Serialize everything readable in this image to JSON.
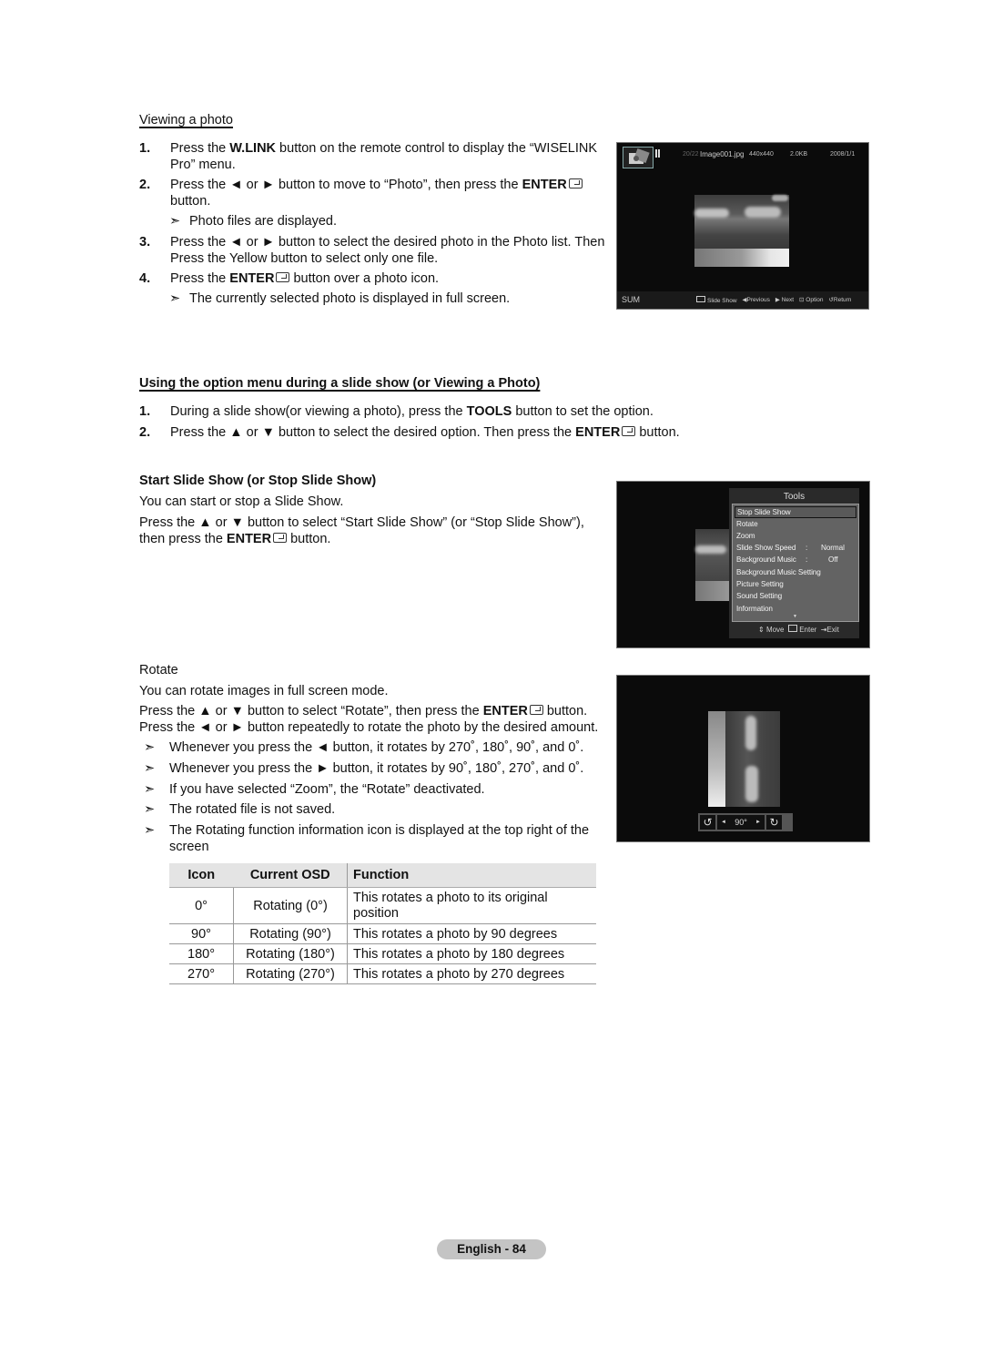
{
  "section1": {
    "heading": "Viewing a photo",
    "steps": [
      {
        "num": "1.",
        "parts": [
          {
            "t": "Press the "
          },
          {
            "b": "W.LINK"
          },
          {
            "t": " button on the remote control to display the “WISELINK Pro” menu."
          }
        ]
      },
      {
        "num": "2.",
        "parts": [
          {
            "t": "Press the ◄ or ► button to move to “Photo”, then press the "
          },
          {
            "b": "ENTER"
          },
          {
            "icon": "enter"
          },
          {
            "t": " button."
          }
        ]
      },
      {
        "num": "3.",
        "parts": [
          {
            "t": "Press the ◄ or ► button to select the desired photo in the Photo list. Then Press the Yellow button to select only one file."
          }
        ]
      },
      {
        "num": "4.",
        "parts": [
          {
            "t": "Press the "
          },
          {
            "b": "ENTER"
          },
          {
            "icon": "enter"
          },
          {
            "t": " button over a photo icon."
          }
        ]
      }
    ],
    "notes": {
      "after_step2": "Photo files are displayed.",
      "after_step4": "The currently selected photo is displayed in full screen."
    },
    "screen": {
      "counter": "20/22",
      "filename": "Image001.jpg",
      "resolution": "440x440",
      "filesize": "2.0KB",
      "date": "2008/1/1",
      "device": "SUM",
      "footer_buttons": [
        {
          "icon": "enter-icon",
          "label": "Slide Show"
        },
        {
          "icon": "left-triangle-icon",
          "label": "Previous"
        },
        {
          "icon": "right-triangle-icon",
          "label": "Next"
        },
        {
          "icon": "tools-icon",
          "label": "Option"
        },
        {
          "icon": "return-icon",
          "label": "Return"
        }
      ]
    }
  },
  "section2": {
    "heading": "Using the option menu during a slide show (or Viewing a Photo)",
    "steps": [
      {
        "num": "1.",
        "parts": [
          {
            "t": "During a slide show(or viewing a photo), press the "
          },
          {
            "b": "TOOLS"
          },
          {
            "t": " button to set the option."
          }
        ]
      },
      {
        "num": "2.",
        "parts": [
          {
            "t": "Press the ▲ or ▼ button to select the desired option. Then press the "
          },
          {
            "b": "ENTER"
          },
          {
            "icon": "enter"
          },
          {
            "t": " button."
          }
        ]
      }
    ]
  },
  "slideshow": {
    "heading": "Start Slide Show (or Stop Slide Show)",
    "line1": "You can start or stop a Slide Show.",
    "line2_parts": [
      {
        "t": "Press the ▲ or ▼ button to select “Start Slide Show” (or “Stop Slide Show”), then press the "
      },
      {
        "b": "ENTER"
      },
      {
        "icon": "enter"
      },
      {
        "t": " button."
      }
    ],
    "tools_menu": {
      "title": "Tools",
      "items": [
        {
          "label": "Stop Slide Show",
          "value": "",
          "selected": true
        },
        {
          "label": "Rotate",
          "value": ""
        },
        {
          "label": "Zoom",
          "value": ""
        },
        {
          "label": "Slide Show Speed",
          "sep": ":",
          "value": "Normal"
        },
        {
          "label": "Background Music",
          "sep": ":",
          "value": "Off"
        },
        {
          "label": "Background Music Setting",
          "value": ""
        },
        {
          "label": "Picture Setting",
          "value": ""
        },
        {
          "label": "Sound Setting",
          "value": ""
        },
        {
          "label": "Information",
          "value": ""
        }
      ],
      "footer": {
        "move": "Move",
        "enter": "Enter",
        "exit": "Exit"
      }
    }
  },
  "rotate": {
    "heading": "Rotate",
    "line1": "You can rotate images in full screen mode.",
    "line2_parts": [
      {
        "t": "Press the ▲ or ▼ button to select “Rotate”, then press the "
      },
      {
        "b": "ENTER"
      },
      {
        "icon": "enter"
      },
      {
        "t": " button. Press the ◄ or ► button repeatedly to rotate the photo by the desired amount."
      }
    ],
    "notes": [
      "Whenever you press the ◄ button, it rotates by 270˚, 180˚, 90˚, and 0˚.",
      "Whenever you press the ► button, it rotates by 90˚, 180˚, 270˚, and 0˚.",
      "If you have selected “Zoom”, the “Rotate” deactivated.",
      "The rotated file is not saved.",
      "The Rotating function information icon is displayed at the top right of the screen"
    ],
    "osd_angle": "90°",
    "table": {
      "headers": [
        "Icon",
        "Current OSD",
        "Function"
      ],
      "rows": [
        [
          "0°",
          "Rotating (0°)",
          "This rotates a photo to its original position"
        ],
        [
          "90°",
          "Rotating (90°)",
          "This rotates a photo by 90 degrees"
        ],
        [
          "180°",
          "Rotating (180°)",
          "This rotates a photo by 180 degrees"
        ],
        [
          "270°",
          "Rotating (270°)",
          "This rotates a photo by 270 degrees"
        ]
      ]
    }
  },
  "footer": {
    "page_label": "English - 84"
  },
  "note_arrow": "➣"
}
